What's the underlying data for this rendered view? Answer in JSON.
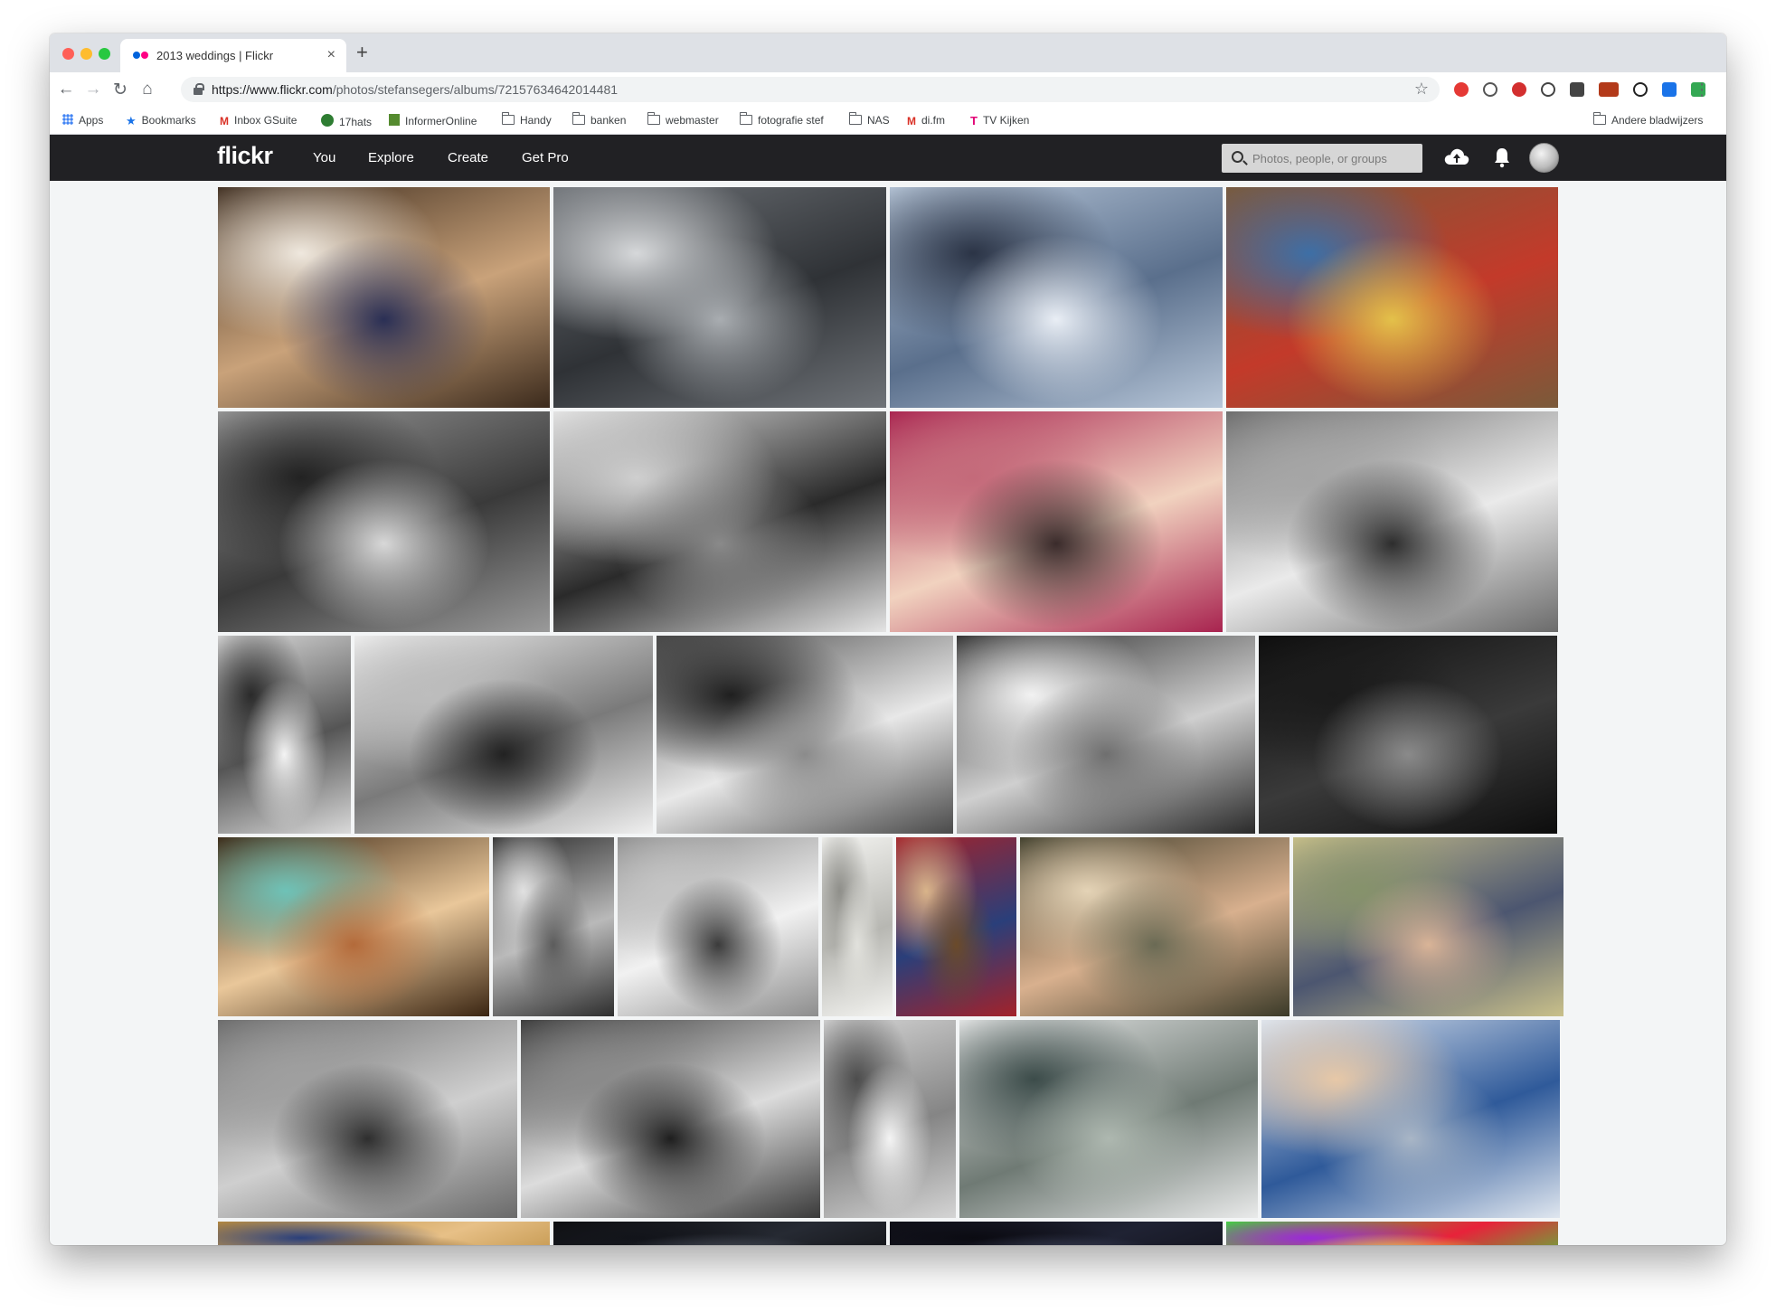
{
  "browser": {
    "tab_title": "2013 weddings | Flickr",
    "url_domain": "https://www.flickr.com",
    "url_path": "/photos/stefansegers/albums/72157634642014481",
    "bookmarks": [
      {
        "label": "Apps",
        "icon": "apps-grid-icon"
      },
      {
        "label": "Bookmarks",
        "icon": "star-icon"
      },
      {
        "label": "Inbox GSuite",
        "icon": "gmail-icon"
      },
      {
        "label": "17hats",
        "icon": "17hats-icon"
      },
      {
        "label": "InformerOnline",
        "icon": "informer-icon"
      },
      {
        "label": "Handy",
        "icon": "folder-icon"
      },
      {
        "label": "banken",
        "icon": "folder-icon"
      },
      {
        "label": "webmaster",
        "icon": "folder-icon"
      },
      {
        "label": "fotografie stef",
        "icon": "folder-icon"
      },
      {
        "label": "NAS",
        "icon": "folder-icon"
      },
      {
        "label": "di.fm",
        "icon": "gmail-icon"
      },
      {
        "label": "TV Kijken",
        "icon": "tmobile-icon"
      }
    ],
    "other_bookmarks": "Andere bladwijzers"
  },
  "flickr": {
    "logo": "flickr",
    "nav": [
      "You",
      "Explore",
      "Create",
      "Get Pro"
    ],
    "search_placeholder": "Photos, people, or groups"
  },
  "colors": {
    "header_bg": "#212124",
    "flickr_blue": "#0063dc",
    "flickr_pink": "#ff0084",
    "page_bg": "#f3f5f6"
  },
  "photo_grid": [
    [
      {
        "name": "couple-in-car-with-camera",
        "colors": [
          "#3b2a1c",
          "#c9a27a",
          "#2a2f55",
          "#efe8de"
        ]
      },
      {
        "name": "groomsmen-on-bridge",
        "colors": [
          "#6f7378",
          "#2f3236",
          "#a9adb1",
          "#d6d8da"
        ]
      },
      {
        "name": "couple-in-snow-landscape",
        "colors": [
          "#b8c7d9",
          "#5a6f8c",
          "#e9eef5",
          "#2b3446"
        ]
      },
      {
        "name": "couple-in-supermarket",
        "colors": [
          "#7a5a3a",
          "#c33a2a",
          "#e3c14a",
          "#3d6fa6"
        ]
      }
    ],
    [
      {
        "name": "couple-in-train-bw",
        "colors": [
          "#9a9a9a",
          "#3a3a3a",
          "#d8d8d8",
          "#222222"
        ]
      },
      {
        "name": "elderly-guests-bw",
        "colors": [
          "#e4e4e4",
          "#2a2a2a",
          "#8a8a8a",
          "#cfcfcf"
        ]
      },
      {
        "name": "group-shot-from-below",
        "colors": [
          "#a8234f",
          "#f1d2bf",
          "#3a2b2b",
          "#c46a7a"
        ]
      },
      {
        "name": "couple-in-hallway-bw",
        "colors": [
          "#6b6b6b",
          "#eaeaea",
          "#2d2d2d",
          "#a5a5a5"
        ]
      }
    ],
    [
      {
        "name": "bride-veil-bw",
        "colors": [
          "#d9d9d9",
          "#555555",
          "#f4f4f4",
          "#2a2a2a"
        ]
      },
      {
        "name": "shoes-on-car-bw",
        "colors": [
          "#f0f0f0",
          "#7a7a7a",
          "#222222",
          "#bdbdbd"
        ]
      },
      {
        "name": "couple-on-steps-bw",
        "colors": [
          "#4a4a4a",
          "#e8e8e8",
          "#8b8b8b",
          "#1f1f1f"
        ]
      },
      {
        "name": "toast-at-dinner-bw",
        "colors": [
          "#2a2a2a",
          "#cfcfcf",
          "#6f6f6f",
          "#f2f2f2"
        ]
      },
      {
        "name": "dance-spotlight-bw",
        "colors": [
          "#0d0d0d",
          "#3a3a3a",
          "#8a8a8a",
          "#1b1b1b"
        ]
      }
    ],
    [
      {
        "name": "friends-party-pose",
        "colors": [
          "#3a2512",
          "#e9c79a",
          "#b36a3a",
          "#6ec2b7"
        ]
      },
      {
        "name": "laughing-guest-bw",
        "colors": [
          "#2e2e2e",
          "#b9b9b9",
          "#5c5c5c",
          "#e1e1e1"
        ]
      },
      {
        "name": "couple-seated-bw",
        "colors": [
          "#8d8d8d",
          "#f1f1f1",
          "#3b3b3b",
          "#c4c4c4"
        ]
      },
      {
        "name": "window-door-detail",
        "colors": [
          "#f3f3f0",
          "#b7b7b2",
          "#e1e1dc",
          "#8f8f8a"
        ]
      },
      {
        "name": "red-carpet-stairs",
        "colors": [
          "#a3222a",
          "#2a3f7a",
          "#6b4a2a",
          "#d9b48a"
        ]
      },
      {
        "name": "groom-glasses-emotional",
        "colors": [
          "#3b3a28",
          "#d8b08e",
          "#6a6a54",
          "#e4d3b6"
        ]
      },
      {
        "name": "groom-wiping-tears",
        "colors": [
          "#c9c08a",
          "#4c5670",
          "#d9b497",
          "#86926b"
        ]
      }
    ],
    [
      {
        "name": "couple-in-forest-bw",
        "colors": [
          "#6a6a6a",
          "#cfcfcf",
          "#2e2e2e",
          "#9f9f9f"
        ]
      },
      {
        "name": "couple-kiss-with-guests-bw",
        "colors": [
          "#3a3a3a",
          "#dcdcdc",
          "#1e1e1e",
          "#8a8a8a"
        ]
      },
      {
        "name": "vintage-car-on-lane-bw",
        "colors": [
          "#d4d4d4",
          "#858585",
          "#f4f4f4",
          "#4d4d4d"
        ]
      },
      {
        "name": "couple-on-station-bridge",
        "colors": [
          "#e9eaea",
          "#6f7a74",
          "#aeb8b0",
          "#3c4c4a"
        ]
      },
      {
        "name": "couple-kiss-by-tram",
        "colors": [
          "#dfe6ef",
          "#2f5a9a",
          "#a9b6c6",
          "#e7c8a7"
        ]
      }
    ],
    [
      {
        "name": "wedding-guest-portrait",
        "colors": [
          "#b88a3c",
          "#e7c087",
          "#6a4a1f",
          "#2a3f7a"
        ]
      },
      {
        "name": "dark-reception",
        "colors": [
          "#0e0e10",
          "#262a33",
          "#4a4f5a",
          "#12141a"
        ]
      },
      {
        "name": "night-lights",
        "colors": [
          "#101018",
          "#1f2233",
          "#3a3f55",
          "#0b0b12"
        ]
      },
      {
        "name": "colorful-party-lights",
        "colors": [
          "#3dd93a",
          "#e8223a",
          "#f0e14a",
          "#9a2ad9"
        ]
      }
    ]
  ]
}
